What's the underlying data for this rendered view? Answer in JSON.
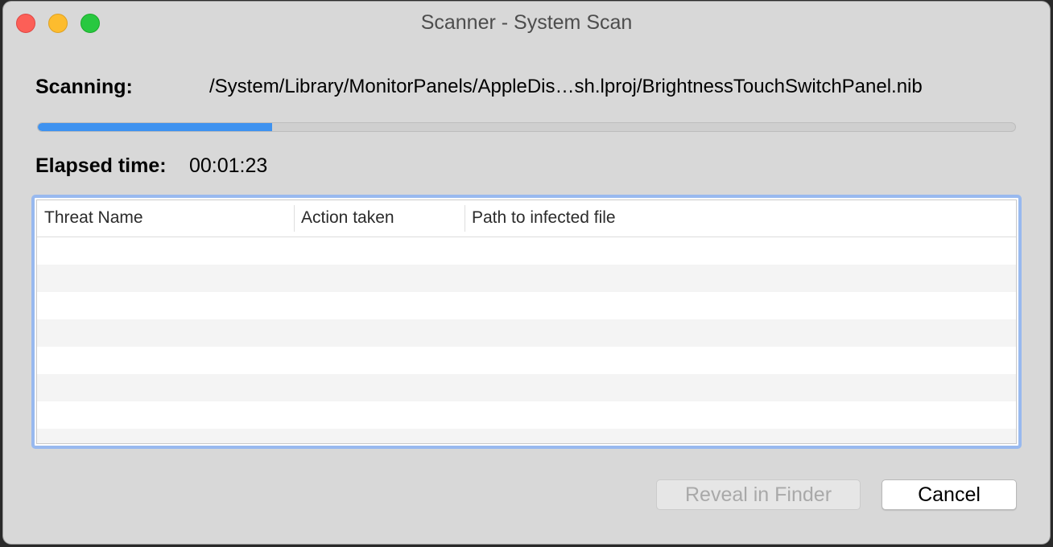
{
  "window": {
    "title": "Scanner - System Scan"
  },
  "scan": {
    "label": "Scanning:",
    "path": "/System/Library/MonitorPanels/AppleDis…sh.lproj/BrightnessTouchSwitchPanel.nib",
    "progress_fraction": 0.24
  },
  "elapsed": {
    "label": "Elapsed time:",
    "value": "00:01:23"
  },
  "table": {
    "columns": [
      "Threat Name",
      "Action taken",
      "Path to infected file"
    ],
    "rows": []
  },
  "buttons": {
    "reveal_label": "Reveal in Finder",
    "cancel_label": "Cancel"
  },
  "colors": {
    "accent": "#3e92f0",
    "focus_ring": "#98b9ef",
    "close": "#fc5f57",
    "minimize": "#fdbc2e",
    "zoom": "#28c840"
  }
}
